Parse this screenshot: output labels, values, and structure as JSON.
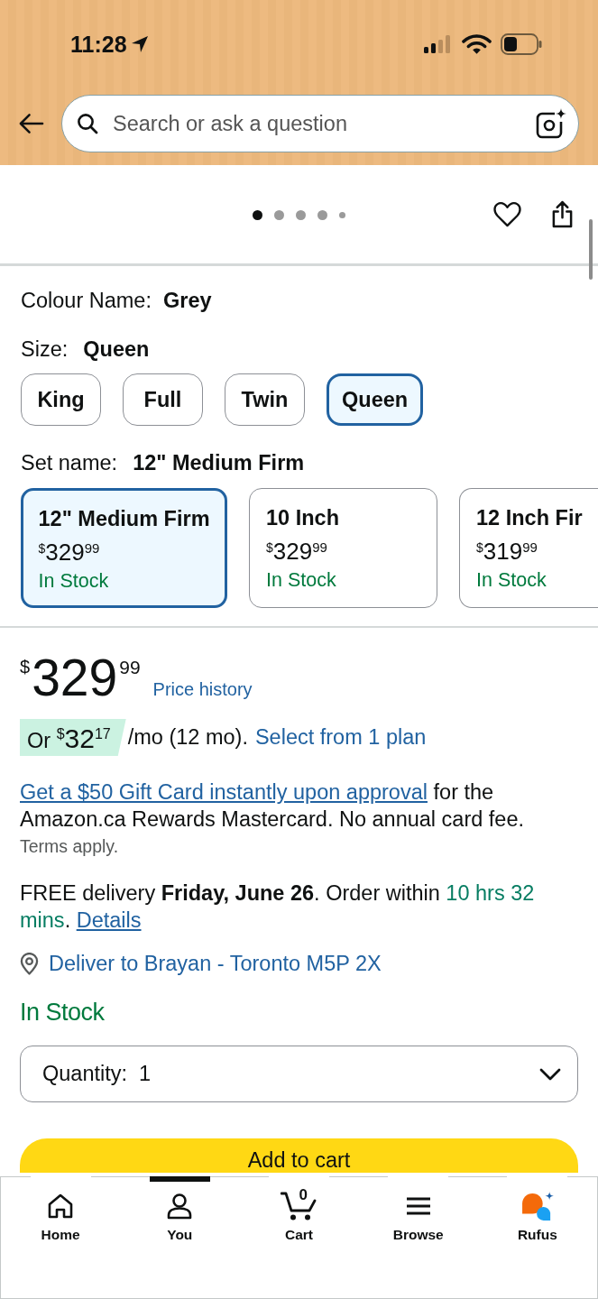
{
  "status_bar": {
    "time": "11:28"
  },
  "search": {
    "placeholder": "Search or ask a question"
  },
  "image_dots": [
    {
      "selected": true
    },
    {
      "selected": false
    },
    {
      "selected": false
    },
    {
      "selected": false
    },
    {
      "selected": false
    }
  ],
  "colour": {
    "label": "Colour Name:",
    "value": "Grey"
  },
  "size": {
    "label": "Size:",
    "value": "Queen",
    "options": [
      {
        "label": "King",
        "selected": false
      },
      {
        "label": "Full",
        "selected": false
      },
      {
        "label": "Twin",
        "selected": false
      },
      {
        "label": "Queen",
        "selected": true
      }
    ]
  },
  "set_name": {
    "label": "Set name:",
    "value": "12\" Medium Firm",
    "options": [
      {
        "title": "12\" Medium Firm",
        "currency": "$",
        "whole": "329",
        "fraction": "99",
        "availability": "In Stock",
        "selected": true
      },
      {
        "title": "10 Inch",
        "currency": "$",
        "whole": "329",
        "fraction": "99",
        "availability": "In Stock",
        "selected": false
      },
      {
        "title": "12 Inch Fir",
        "currency": "$",
        "whole": "319",
        "fraction": "99",
        "availability": "In Stock",
        "selected": false
      }
    ]
  },
  "price": {
    "currency": "$",
    "whole": "329",
    "fraction": "99",
    "history_link": "Price history"
  },
  "installment": {
    "prefix": "Or",
    "currency": "$",
    "whole": "32",
    "fraction": "17",
    "terms": "/mo (12 mo).",
    "link": "Select from 1 plan"
  },
  "card_offer": {
    "link": "Get a $50 Gift Card instantly upon approval",
    "text": "for the Amazon.ca Rewards Mastercard. No annual card fee.",
    "terms": "Terms apply."
  },
  "delivery": {
    "text": "FREE delivery **Friday, June 26**. Order within",
    "countdown": "10 hrs 32 mins",
    "after": ".",
    "link": "Details"
  },
  "deliver_to": "Deliver to Brayan - Toronto M5P 2X",
  "availability": "In Stock",
  "quantity": {
    "label": "Quantity:",
    "value": "1"
  },
  "add_to_cart": "Add to cart",
  "bottom_nav": [
    {
      "label": "Home",
      "selected": false
    },
    {
      "label": "You",
      "selected": true
    },
    {
      "label": "Cart",
      "selected": false,
      "count": "0"
    },
    {
      "label": "Browse",
      "selected": false
    },
    {
      "label": "Rufus",
      "selected": false
    }
  ]
}
